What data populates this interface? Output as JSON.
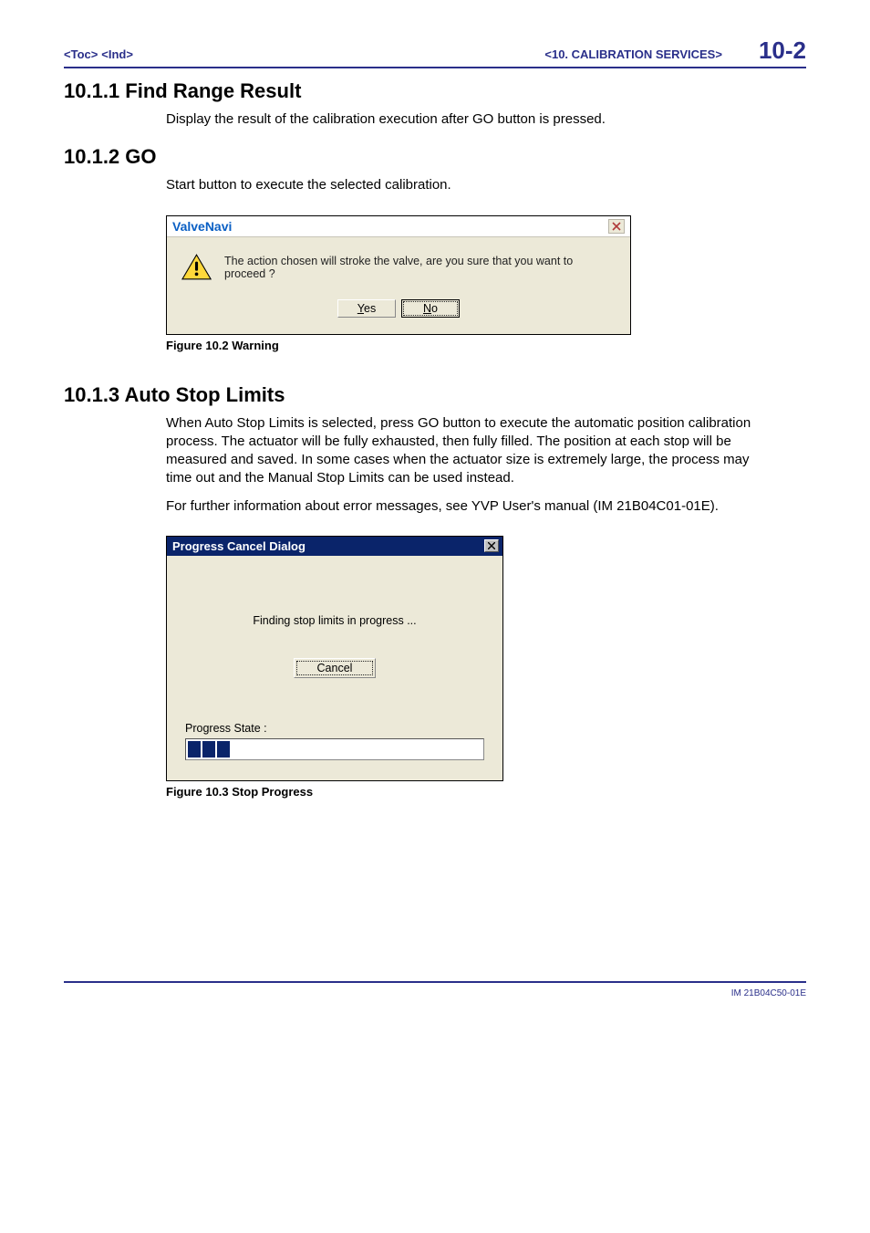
{
  "header": {
    "toc": "<Toc>",
    "ind": "<Ind>",
    "section_label": "<10.  CALIBRATION SERVICES>",
    "page_num": "10-2"
  },
  "sections": {
    "s1": {
      "title": "10.1.1  Find Range Result",
      "body": "Display the result of the calibration execution after GO button is pressed."
    },
    "s2": {
      "title": "10.1.2  GO",
      "body": "Start button to execute the selected calibration."
    },
    "s3": {
      "title": "10.1.3  Auto Stop Limits",
      "body1": "When Auto Stop Limits is selected, press GO button to execute the automatic position calibration process.  The actuator will be fully exhausted, then fully filled.  The position at each stop will be measured and saved.  In some cases when the actuator size is extremely large, the process may time out and the Manual Stop Limits can be used instead.",
      "body2": "For further information about error messages, see YVP User's manual (IM 21B04C01-01E)."
    }
  },
  "dialog_warning": {
    "title": "ValveNavi",
    "message": "The action chosen will stroke the valve, are you sure that you want to proceed ?",
    "yes_u": "Y",
    "yes_rest": "es",
    "no_u": "N",
    "no_rest": "o",
    "caption": "Figure 10.2 Warning"
  },
  "dialog_progress": {
    "title": "Progress Cancel Dialog",
    "message": "Finding stop limits in progress ...",
    "cancel": "Cancel",
    "state_label": "Progress State :",
    "caption": "Figure 10.3 Stop Progress",
    "segments": 3
  },
  "footer": {
    "doc_id": "IM 21B04C50-01E"
  }
}
